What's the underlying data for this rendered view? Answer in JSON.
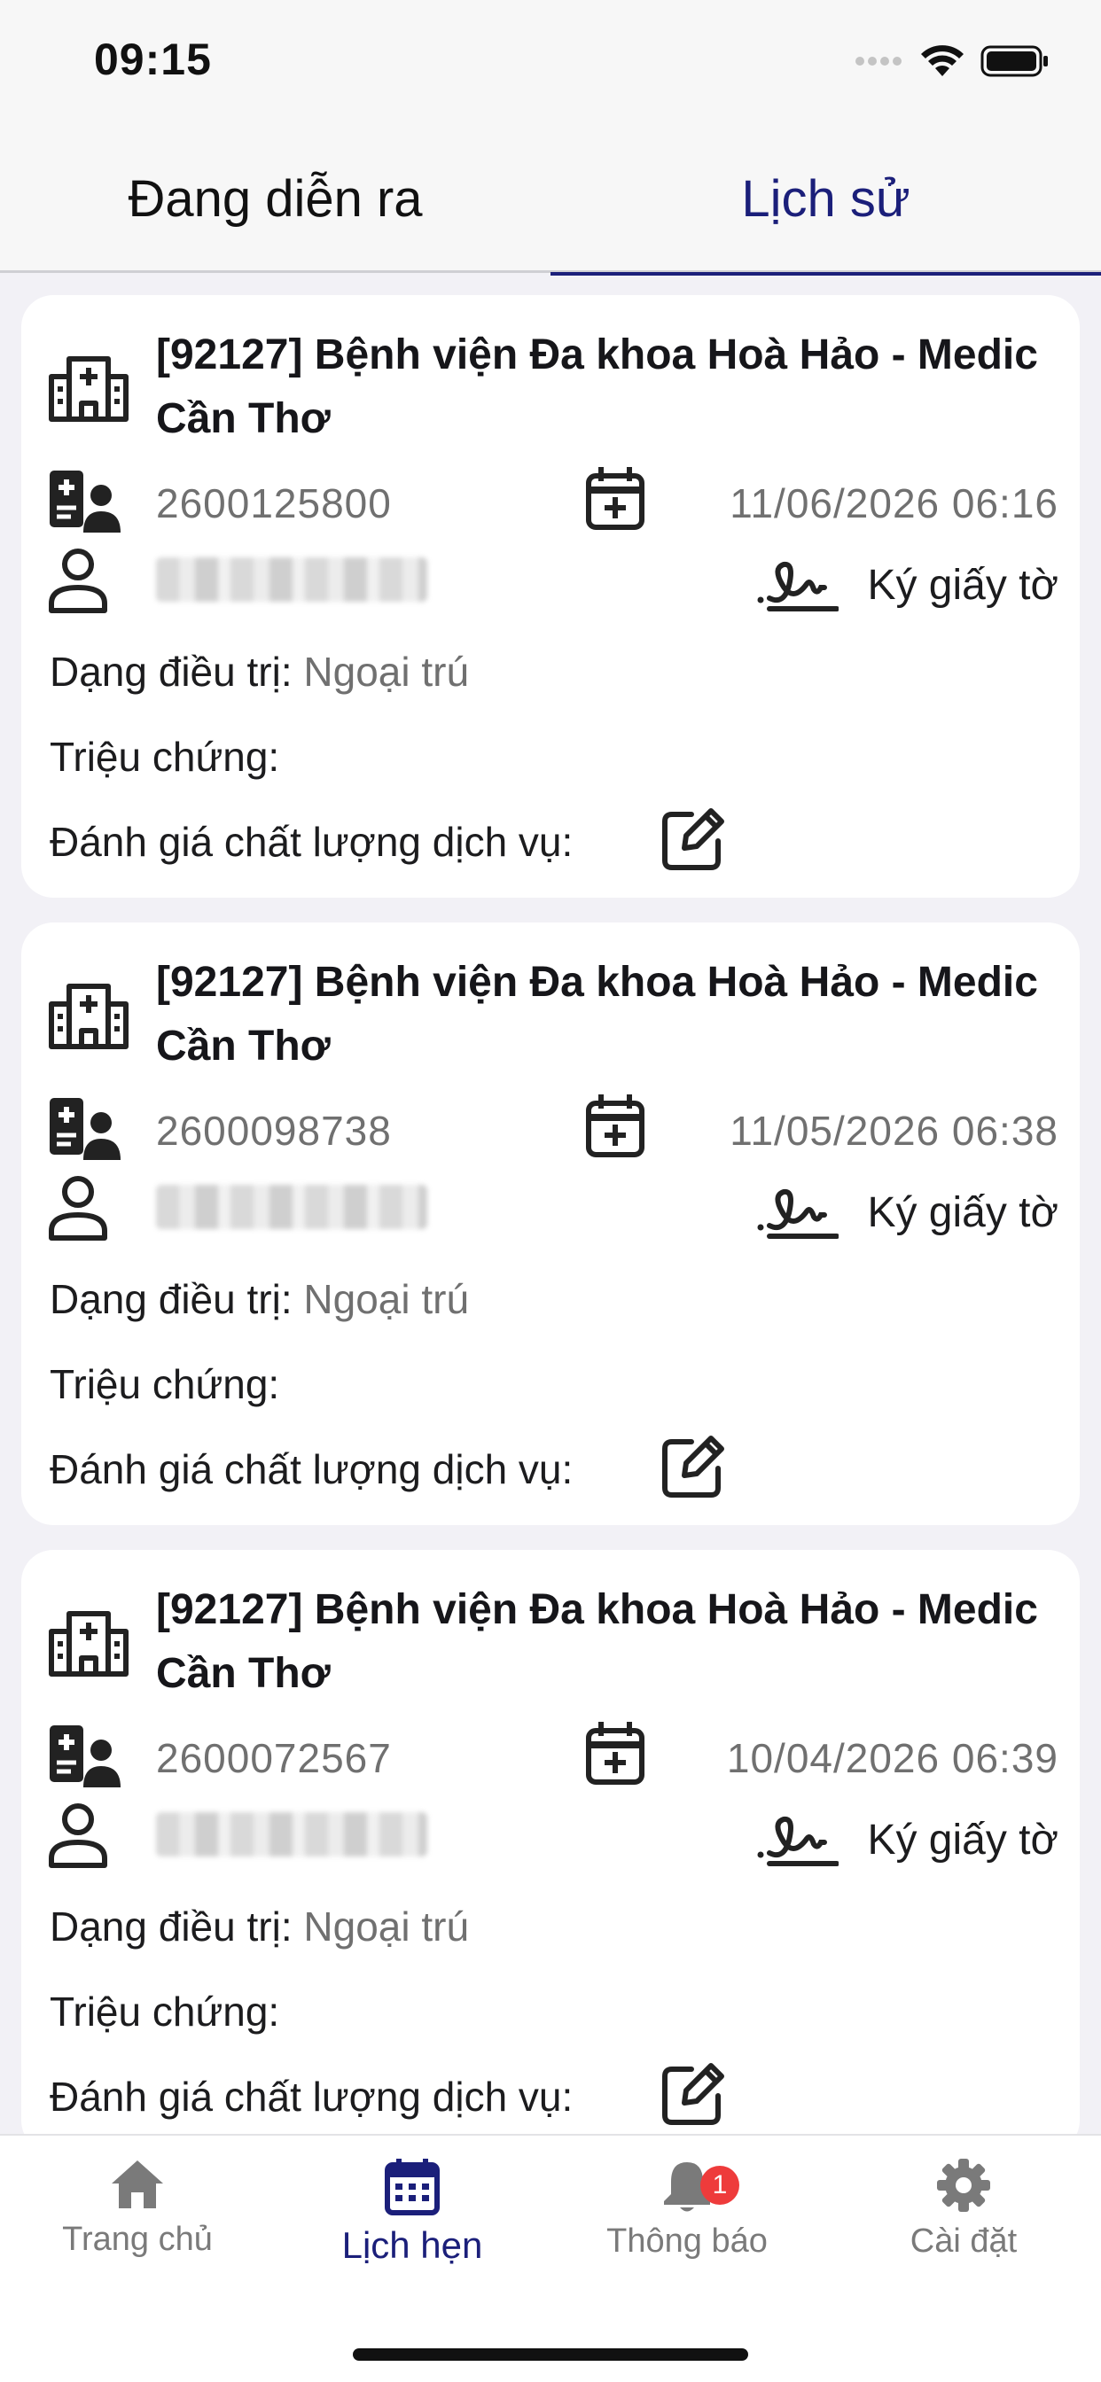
{
  "status_bar": {
    "time": "09:15"
  },
  "tabs": [
    {
      "label": "Đang diễn ra",
      "active": false
    },
    {
      "label": "Lịch sử",
      "active": true
    }
  ],
  "appointments": [
    {
      "hospital": "[92127] Bệnh viện Đa khoa Hoà Hảo - Medic Cần Thơ",
      "record_id": "2600125800",
      "date": "11/06/2026 06:16",
      "sign_label": "Ký giấy tờ",
      "treatment_label": "Dạng điều trị:",
      "treatment_value": "Ngoại trú",
      "symptom_label": "Triệu chứng:",
      "rating_label": "Đánh giá chất lượng dịch vụ:"
    },
    {
      "hospital": "[92127] Bệnh viện Đa khoa Hoà Hảo - Medic Cần Thơ",
      "record_id": "2600098738",
      "date": "11/05/2026 06:38",
      "sign_label": "Ký giấy tờ",
      "treatment_label": "Dạng điều trị:",
      "treatment_value": "Ngoại trú",
      "symptom_label": "Triệu chứng:",
      "rating_label": "Đánh giá chất lượng dịch vụ:"
    },
    {
      "hospital": "[92127] Bệnh viện Đa khoa Hoà Hảo - Medic Cần Thơ",
      "record_id": "2600072567",
      "date": "10/04/2026 06:39",
      "sign_label": "Ký giấy tờ",
      "treatment_label": "Dạng điều trị:",
      "treatment_value": "Ngoại trú",
      "symptom_label": "Triệu chứng:",
      "rating_label": "Đánh giá chất lượng dịch vụ:"
    }
  ],
  "bottom_nav": [
    {
      "label": "Trang chủ",
      "icon": "home-icon",
      "active": false
    },
    {
      "label": "Lịch hẹn",
      "icon": "calendar-icon",
      "active": true
    },
    {
      "label": "Thông báo",
      "icon": "bell-icon",
      "active": false,
      "badge": "1"
    },
    {
      "label": "Cài đặt",
      "icon": "gear-icon",
      "active": false
    }
  ],
  "colors": {
    "accent": "#1b1f7a",
    "badge": "#ee3b3b",
    "muted": "#707070"
  }
}
